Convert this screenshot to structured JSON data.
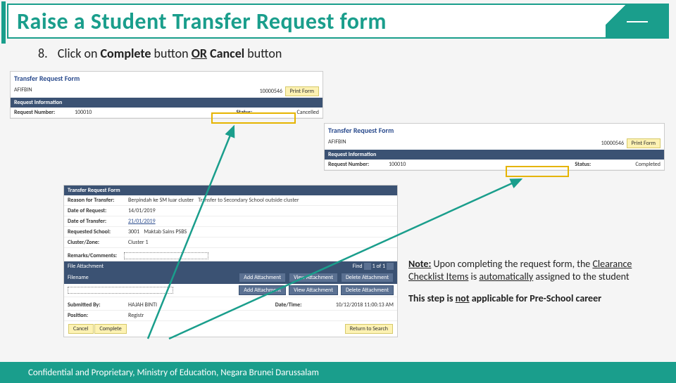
{
  "title": "Raise a Student Transfer Request form",
  "step": {
    "num": "8.",
    "pre": "Click on ",
    "b1": "Complete ",
    "mid1": "button ",
    "or": "OR",
    "mid2": " ",
    "b2": "Cancel ",
    "post": "button"
  },
  "form_header": "Transfer Request Form",
  "req_info": "Request Information",
  "p1": {
    "id_label": "AFIFBIN",
    "id_value": "10000546",
    "print": "Print Form",
    "req_num_l": "Request Number:",
    "req_num_v": "100010",
    "status_l": "Status:",
    "status_v": "Cancelled"
  },
  "p2": {
    "id_label": "AFIFBIN",
    "id_value": "10000546",
    "print": "Print Form",
    "req_num_l": "Request Number:",
    "req_num_v": "100010",
    "status_l": "Status:",
    "status_v": "Completed"
  },
  "p3": {
    "header": "Transfer Request Form",
    "reason_l": "Reason for Transfer:",
    "reason_v": "Berpindah ke SM luar cluster",
    "reason_v2": "Transfer to Secondary School outside cluster",
    "dreq_l": "Date of Request:",
    "dreq_v": "14/01/2019",
    "dtrans_l": "Date of Transfer:",
    "dtrans_v": "21/01/2019",
    "school_l": "Requested School:",
    "school_v": "3001",
    "school_v2": "Maktab Sains PSBS",
    "cluster_l": "Cluster/Zone:",
    "cluster_v": "Cluster 1",
    "remarks_l": "Remarks/Comments:",
    "file_att": "File Attachment",
    "filename": "Filename",
    "add": "Add Attachment",
    "view": "View Attachment",
    "del": "Delete Attachment",
    "find": "Find",
    "pager": "1 of 1",
    "sub_l": "Submitted By:",
    "sub_v": "HAJAH BINTI",
    "pos_l": "Position:",
    "pos_v": "Registr",
    "dt_l": "Date/Time:",
    "dt_v": "10/12/2018 11:00:13 AM",
    "cancel": "Cancel",
    "complete": "Complete",
    "return": "Return to Search"
  },
  "note": {
    "l1a": "Note:",
    "l1b": " Upon completing the request form, the ",
    "l1c": "Clearance Checklist Items",
    "l1d": " is ",
    "l1e": "automatically",
    "l1f": " assigned to the student",
    "l2a": "This step is ",
    "l2b": "not",
    "l2c": " applicable for Pre-School career"
  },
  "footer": "Confidential and Proprietary, Ministry of Education, Negara Brunei Darussalam"
}
